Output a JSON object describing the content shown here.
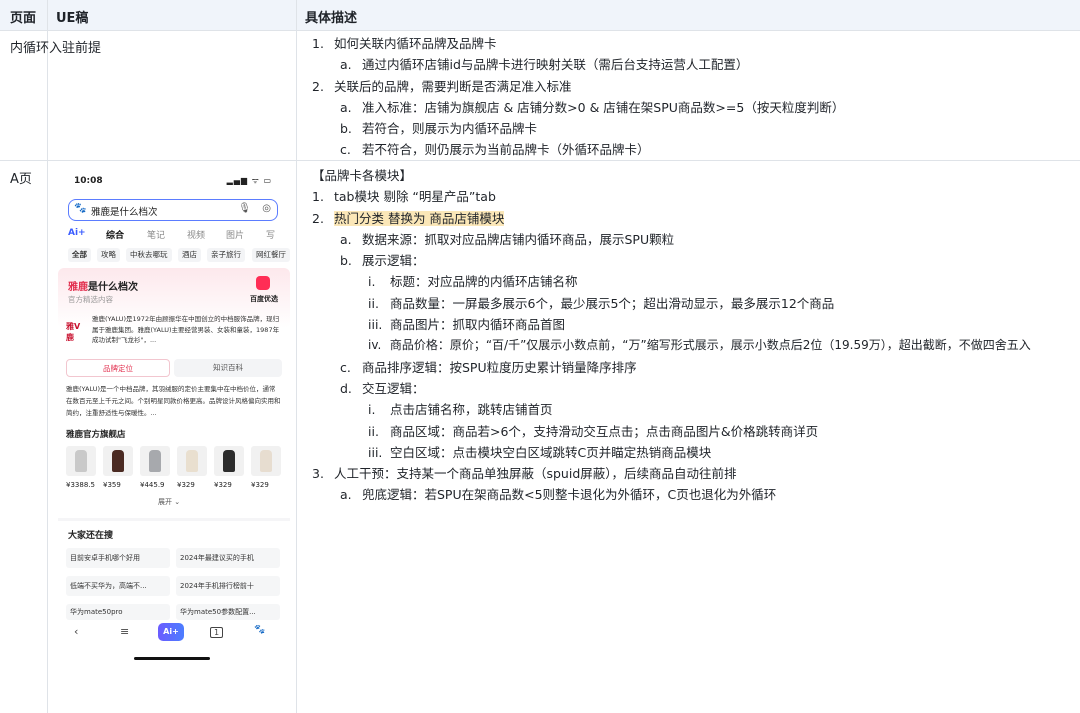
{
  "header": {
    "col_page": "页面",
    "col_ue": "UE稿",
    "col_desc": "具体描述"
  },
  "row1": {
    "page": "内循环入驻前提",
    "lines": [
      {
        "num": "1.",
        "text": "如何关联内循环品牌及品牌卡"
      },
      {
        "num": "a.",
        "text": "通过内循环店铺id与品牌卡进行映射关联（需后台支持运营人工配置）"
      },
      {
        "num": "2.",
        "text": "关联后的品牌，需要判断是否满足准入标准"
      },
      {
        "num": "a.",
        "text": "准入标准：店铺为旗舰店 & 店铺分数>0 & 店铺在架SPU商品数>=5（按天粒度判断）"
      },
      {
        "num": "b.",
        "text": "若符合，则展示为内循环品牌卡"
      },
      {
        "num": "c.",
        "text": "若不符合，则仍展示为当前品牌卡（外循环品牌卡）"
      }
    ]
  },
  "row2": {
    "page": "A页",
    "title": "【品牌卡各模块】",
    "lines": [
      {
        "num": "1.",
        "text": "tab模块 剔除 “明星产品”tab"
      },
      {
        "num": "2.",
        "text": "热门分类 替换为 商品店铺模块"
      },
      {
        "num": "a.",
        "text": "数据来源：抓取对应品牌店铺内循环商品，展示SPU颗粒"
      },
      {
        "num": "b.",
        "text": "展示逻辑："
      },
      {
        "num": "i.",
        "text": "标题：对应品牌的内循环店铺名称"
      },
      {
        "num": "ii.",
        "text": "商品数量：一屏最多展示6个，最少展示5个；超出滑动显示，最多展示12个商品"
      },
      {
        "num": "iii.",
        "text": "商品图片：抓取内循环商品首图"
      },
      {
        "num": "iv.",
        "text": "商品价格：原价；“百/千”仅展示小数点前，“万”缩写形式展示，展示小数点后2位（19.59万），超出截断，不做四舍五入"
      },
      {
        "num": "c.",
        "text": "商品排序逻辑：按SPU粒度历史累计销量降序排序"
      },
      {
        "num": "d.",
        "text": "交互逻辑："
      },
      {
        "num": "i.",
        "text": "点击店铺名称，跳转店铺首页"
      },
      {
        "num": "ii.",
        "text": "商品区域：商品若>6个，支持滑动交互点击；点击商品图片&价格跳转商详页"
      },
      {
        "num": "iii.",
        "text": "空白区域：点击模块空白区域跳转C页并瞄定热销商品模块"
      },
      {
        "num": "3.",
        "text": "人工干预：支持某一个商品单独屏蔽（spuid屏蔽），后续商品自动往前排"
      },
      {
        "num": "a.",
        "text": "兜底逻辑：若SPU在架商品数<5则整卡退化为外循环，C页也退化为外循环"
      }
    ]
  },
  "phone": {
    "time": "10:08",
    "status": "▂▄▆ ᯤ ▭",
    "query": "雅鹿是什么档次",
    "tabs": [
      "Ai+",
      "综合",
      "笔记",
      "视频",
      "图片",
      "写"
    ],
    "chips": [
      "全部",
      "攻略",
      "中秋去哪玩",
      "酒店",
      "亲子旅行",
      "网红餐厅"
    ],
    "card_title_brand": "雅鹿",
    "card_title_rest": "是什么档次",
    "card_sub": "官方精选内容",
    "card_logo": "百度优选",
    "brand_logo": "雅V鹿",
    "brand_text": "雅鹿(YALU)是1972年由顾振华在中国创立的中档服饰品牌，现归属于雅鹿集团。雅鹿(YALU)主要经营男装、女装和童装，1987年成功试制\"飞龙衫\"，...",
    "seg_active": "品牌定位",
    "seg_other": "知识百科",
    "intro": "雅鹿(YALU)是一个中档品牌，其羽绒服的定价主要集中在中档价位，通常在数百元至上千元之间。个别明星同款价格更高。品牌设计风格偏向实用和简约，注重舒适性与保暖性。...",
    "store_name": "雅鹿官方旗舰店",
    "goods": [
      {
        "price": "¥3388.5",
        "color": "#c9c9c9"
      },
      {
        "price": "¥359",
        "color": "#4a2a22"
      },
      {
        "price": "¥445.9",
        "color": "#a7a9ad"
      },
      {
        "price": "¥329",
        "color": "#e9dfcf"
      },
      {
        "price": "¥329",
        "color": "#2c2c2c"
      },
      {
        "price": "¥329",
        "color": "#e7ddd0"
      }
    ],
    "expand": "展开 ⌄",
    "hot_title": "大家还在搜",
    "suggestions": [
      "目前安卓手机哪个好用",
      "2024年最建议买的手机",
      "低端不买华为，高端不...",
      "2024年手机排行榜前十",
      "华为mate50pro",
      "华为mate50参数配置..."
    ],
    "nav": [
      "‹",
      "≡",
      "Ai+",
      "1",
      "🐾"
    ]
  }
}
